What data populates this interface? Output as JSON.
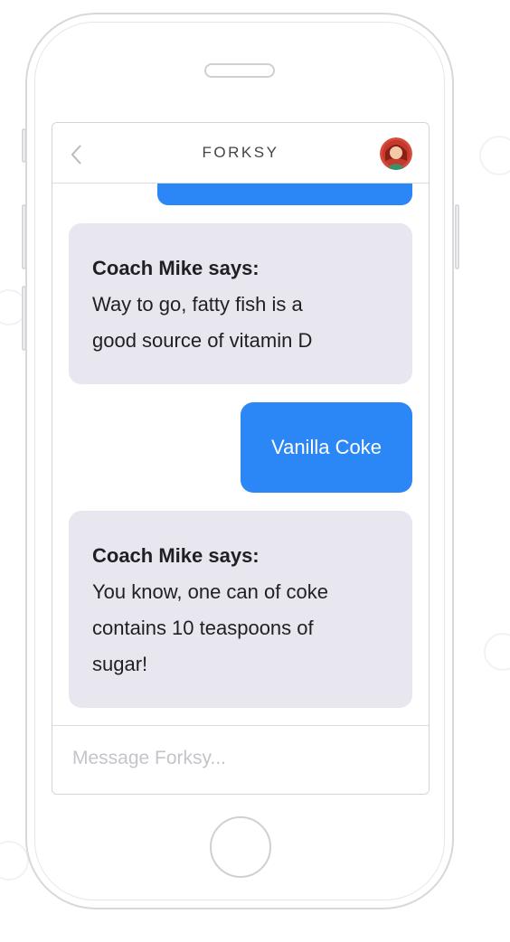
{
  "header": {
    "title": "FORKSY",
    "back_icon": "chevron-left-icon",
    "avatar_icon": "user-avatar"
  },
  "messages": [
    {
      "from": "coach",
      "name": "Coach Mike says:",
      "lines": [
        "Way to go, fatty fish is a",
        "good source of vitamin D"
      ]
    },
    {
      "from": "user",
      "text": "Vanilla Coke"
    },
    {
      "from": "coach",
      "name": "Coach Mike says:",
      "lines": [
        "You know, one can of coke",
        "contains 10 teaspoons of",
        "sugar!"
      ]
    }
  ],
  "composer": {
    "placeholder": "Message Forksy..."
  },
  "colors": {
    "accent": "#2b87f5",
    "coach_bubble": "#e8e6ee",
    "text": "#1f1f24"
  }
}
